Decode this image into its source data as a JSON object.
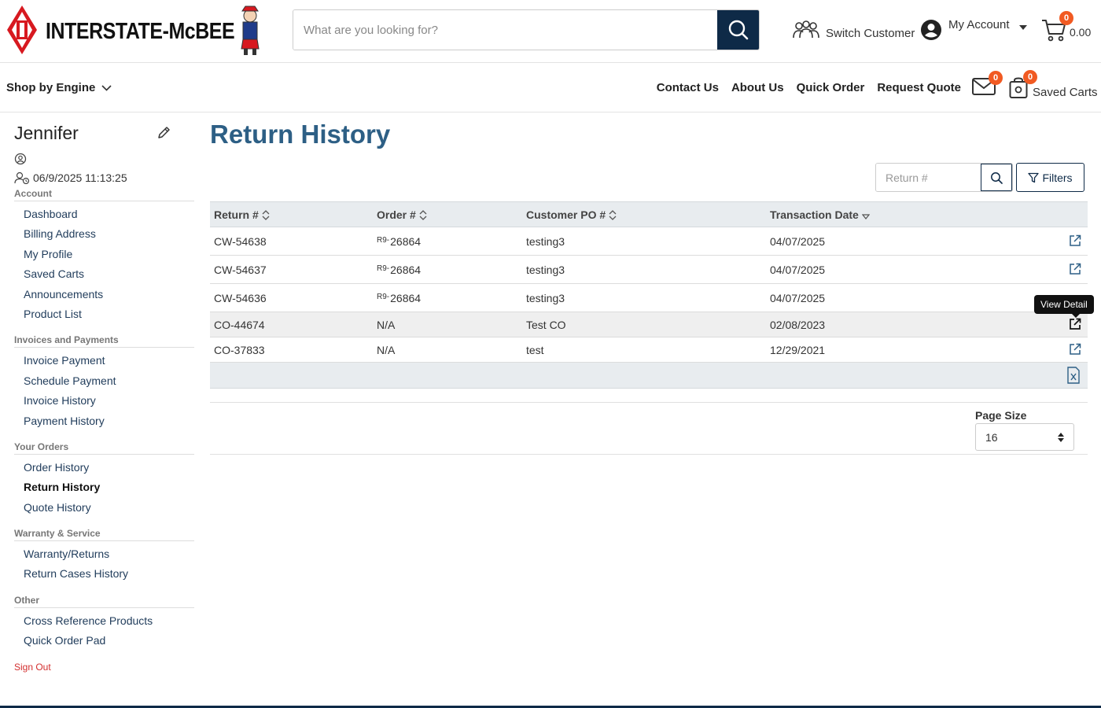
{
  "brand": {
    "name": "INTERSTATE-McBEE",
    "accent": "#0e2a47",
    "logo_red": "#d71920",
    "title_blue": "#2d5f85"
  },
  "header": {
    "search_placeholder": "What are you looking for?",
    "switch_customer": "Switch Customer",
    "my_account": "My Account",
    "cart_count": "0",
    "cart_total": "0.00"
  },
  "nav": {
    "shop_by_engine": "Shop by Engine",
    "links": [
      "Contact Us",
      "About Us",
      "Quick Order",
      "Request Quote"
    ],
    "messages_count": "0",
    "saved_carts_count": "0",
    "saved_carts": "Saved Carts"
  },
  "sidebar": {
    "user_name": "Jennifer",
    "session": "06/9/2025 11:13:25",
    "sections": [
      {
        "title": "Account",
        "items": [
          "Dashboard",
          "Billing Address",
          "My Profile",
          "Saved Carts",
          "Announcements",
          "Product List"
        ]
      },
      {
        "title": "Invoices and Payments",
        "items": [
          "Invoice Payment",
          "Schedule Payment",
          "Invoice History",
          "Payment History"
        ]
      },
      {
        "title": "Your Orders",
        "items": [
          "Order History",
          "Return History",
          "Quote History"
        ]
      },
      {
        "title": "Warranty & Service",
        "items": [
          "Warranty/Returns",
          "Return Cases History"
        ]
      },
      {
        "title": "Other",
        "items": [
          "Cross Reference Products",
          "Quick Order Pad"
        ]
      }
    ],
    "active_item": "Return History",
    "sign_out": "Sign Out"
  },
  "main": {
    "title": "Return History",
    "return_search_placeholder": "Return #",
    "filters": "Filters",
    "columns": [
      "Return #",
      "Order #",
      "Customer PO #",
      "Transaction Date"
    ],
    "rows": [
      {
        "return_no": "CW-54638",
        "order_prefix": "R9-",
        "order_no": "26864",
        "po": "testing3",
        "date": "04/07/2025"
      },
      {
        "return_no": "CW-54637",
        "order_prefix": "R9-",
        "order_no": "26864",
        "po": "testing3",
        "date": "04/07/2025"
      },
      {
        "return_no": "CW-54636",
        "order_prefix": "R9-",
        "order_no": "26864",
        "po": "testing3",
        "date": "04/07/2025"
      },
      {
        "return_no": "CO-44674",
        "order_prefix": "",
        "order_no": "N/A",
        "po": "Test CO",
        "date": "02/08/2023"
      },
      {
        "return_no": "CO-37833",
        "order_prefix": "",
        "order_no": "N/A",
        "po": "test",
        "date": "12/29/2021"
      }
    ],
    "tooltip": "View Detail",
    "page_size_label": "Page Size",
    "page_size_value": "16"
  }
}
